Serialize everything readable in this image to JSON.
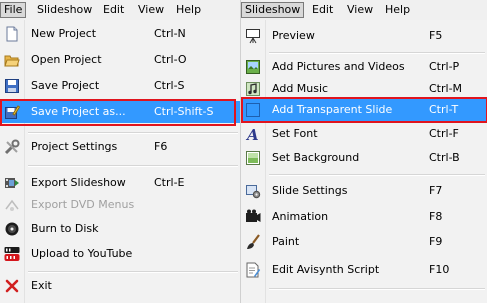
{
  "left": {
    "menubar": [
      "File",
      "Slideshow",
      "Edit",
      "View",
      "Help"
    ],
    "items": [
      {
        "label": "New Project",
        "shortcut": "Ctrl-N",
        "icon": "new-project-icon"
      },
      {
        "label": "Open Project",
        "shortcut": "Ctrl-O",
        "icon": "open-folder-icon"
      },
      {
        "label": "Save Project",
        "shortcut": "Ctrl-S",
        "icon": "save-disk-icon"
      },
      {
        "label": "Save Project as...",
        "shortcut": "Ctrl-Shift-S",
        "icon": "save-as-icon"
      },
      {
        "label": "Project Settings",
        "shortcut": "F6",
        "icon": "tools-icon"
      },
      {
        "label": "Export Slideshow",
        "shortcut": "Ctrl-E",
        "icon": "film-export-icon"
      },
      {
        "label": "Export DVD Menus",
        "shortcut": "",
        "icon": "dvd-menu-icon"
      },
      {
        "label": "Burn to Disk",
        "shortcut": "",
        "icon": "disc-icon"
      },
      {
        "label": "Upload to YouTube",
        "shortcut": "",
        "icon": "youtube-icon"
      },
      {
        "label": "Exit",
        "shortcut": "",
        "icon": "close-icon"
      }
    ]
  },
  "right": {
    "menubar": [
      "Slideshow",
      "Edit",
      "View",
      "Help"
    ],
    "items": [
      {
        "label": "Preview",
        "shortcut": "F5",
        "icon": "preview-screen-icon"
      },
      {
        "label": "Add Pictures and Videos",
        "shortcut": "Ctrl-P",
        "icon": "add-pictures-icon"
      },
      {
        "label": "Add Music",
        "shortcut": "Ctrl-M",
        "icon": "music-icon"
      },
      {
        "label": "Add Transparent Slide",
        "shortcut": "Ctrl-T",
        "icon": "transparent-slide-icon"
      },
      {
        "label": "Set Font",
        "shortcut": "Ctrl-F",
        "icon": "font-icon"
      },
      {
        "label": "Set Background",
        "shortcut": "Ctrl-B",
        "icon": "background-icon"
      },
      {
        "label": "Slide Settings",
        "shortcut": "F7",
        "icon": "slide-settings-icon"
      },
      {
        "label": "Animation",
        "shortcut": "F8",
        "icon": "animation-icon"
      },
      {
        "label": "Paint",
        "shortcut": "F9",
        "icon": "paint-brush-icon"
      },
      {
        "label": "Edit Avisynth Script",
        "shortcut": "F10",
        "icon": "script-edit-icon"
      }
    ]
  },
  "colors": {
    "highlight": "#3399ff",
    "annotation": "#e0141e"
  }
}
